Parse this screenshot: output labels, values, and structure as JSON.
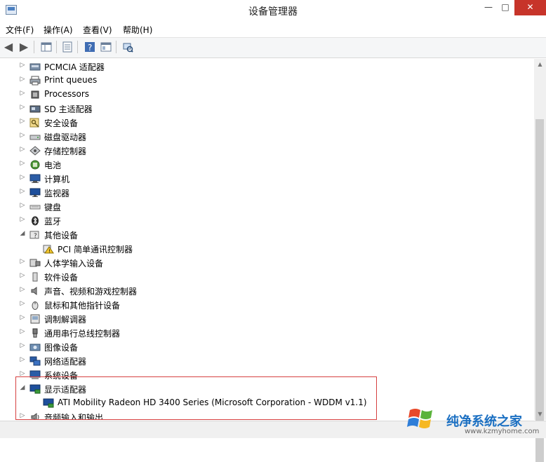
{
  "window": {
    "title": "设备管理器"
  },
  "menu": [
    {
      "label": "文件(F)"
    },
    {
      "label": "操作(A)"
    },
    {
      "label": "查看(V)"
    },
    {
      "label": "帮助(H)"
    }
  ],
  "tree": [
    {
      "label": "PCMCIA 适配器",
      "icon": "pcmcia-icon",
      "expanded": false,
      "level": 0
    },
    {
      "label": "Print queues",
      "icon": "printer-icon",
      "expanded": false,
      "level": 0
    },
    {
      "label": "Processors",
      "icon": "processor-icon",
      "expanded": false,
      "level": 0
    },
    {
      "label": "SD 主适配器",
      "icon": "sd-host-icon",
      "expanded": false,
      "level": 0
    },
    {
      "label": "安全设备",
      "icon": "key-icon",
      "expanded": false,
      "level": 0
    },
    {
      "label": "磁盘驱动器",
      "icon": "disk-drive-icon",
      "expanded": false,
      "level": 0
    },
    {
      "label": "存储控制器",
      "icon": "storage-controller-icon",
      "expanded": false,
      "level": 0
    },
    {
      "label": "电池",
      "icon": "battery-icon",
      "expanded": false,
      "level": 0
    },
    {
      "label": "计算机",
      "icon": "computer-icon",
      "expanded": false,
      "level": 0
    },
    {
      "label": "监视器",
      "icon": "monitor-icon",
      "expanded": false,
      "level": 0
    },
    {
      "label": "键盘",
      "icon": "keyboard-icon",
      "expanded": false,
      "level": 0
    },
    {
      "label": "蓝牙",
      "icon": "bluetooth-icon",
      "expanded": false,
      "level": 0
    },
    {
      "label": "其他设备",
      "icon": "other-devices-icon",
      "expanded": true,
      "level": 0
    },
    {
      "label": "PCI 简单通讯控制器",
      "icon": "warning-device-icon",
      "expanded": null,
      "level": 1
    },
    {
      "label": "人体学输入设备",
      "icon": "hid-icon",
      "expanded": false,
      "level": 0
    },
    {
      "label": "软件设备",
      "icon": "software-device-icon",
      "expanded": false,
      "level": 0
    },
    {
      "label": "声音、视频和游戏控制器",
      "icon": "speaker-icon",
      "expanded": false,
      "level": 0
    },
    {
      "label": "鼠标和其他指针设备",
      "icon": "mouse-icon",
      "expanded": false,
      "level": 0
    },
    {
      "label": "调制解调器",
      "icon": "modem-icon",
      "expanded": false,
      "level": 0
    },
    {
      "label": "通用串行总线控制器",
      "icon": "usb-icon",
      "expanded": false,
      "level": 0
    },
    {
      "label": "图像设备",
      "icon": "camera-icon",
      "expanded": false,
      "level": 0
    },
    {
      "label": "网络适配器",
      "icon": "network-adapter-icon",
      "expanded": false,
      "level": 0
    },
    {
      "label": "系统设备",
      "icon": "system-device-icon",
      "expanded": false,
      "level": 0
    },
    {
      "label": "显示适配器",
      "icon": "display-adapter-icon",
      "expanded": true,
      "level": 0
    },
    {
      "label": "ATI Mobility Radeon HD 3400 Series (Microsoft Corporation - WDDM v1.1)",
      "icon": "display-card-icon",
      "expanded": null,
      "level": 1
    },
    {
      "label": "音频输入和输出",
      "icon": "audio-io-icon",
      "expanded": false,
      "level": 0
    }
  ],
  "watermark": {
    "title": "纯净系统之家",
    "url": "www.kzmyhome.com"
  },
  "colors": {
    "accent": "#1a6fc2",
    "close": "#c7342a",
    "highlight": "#d64040"
  }
}
